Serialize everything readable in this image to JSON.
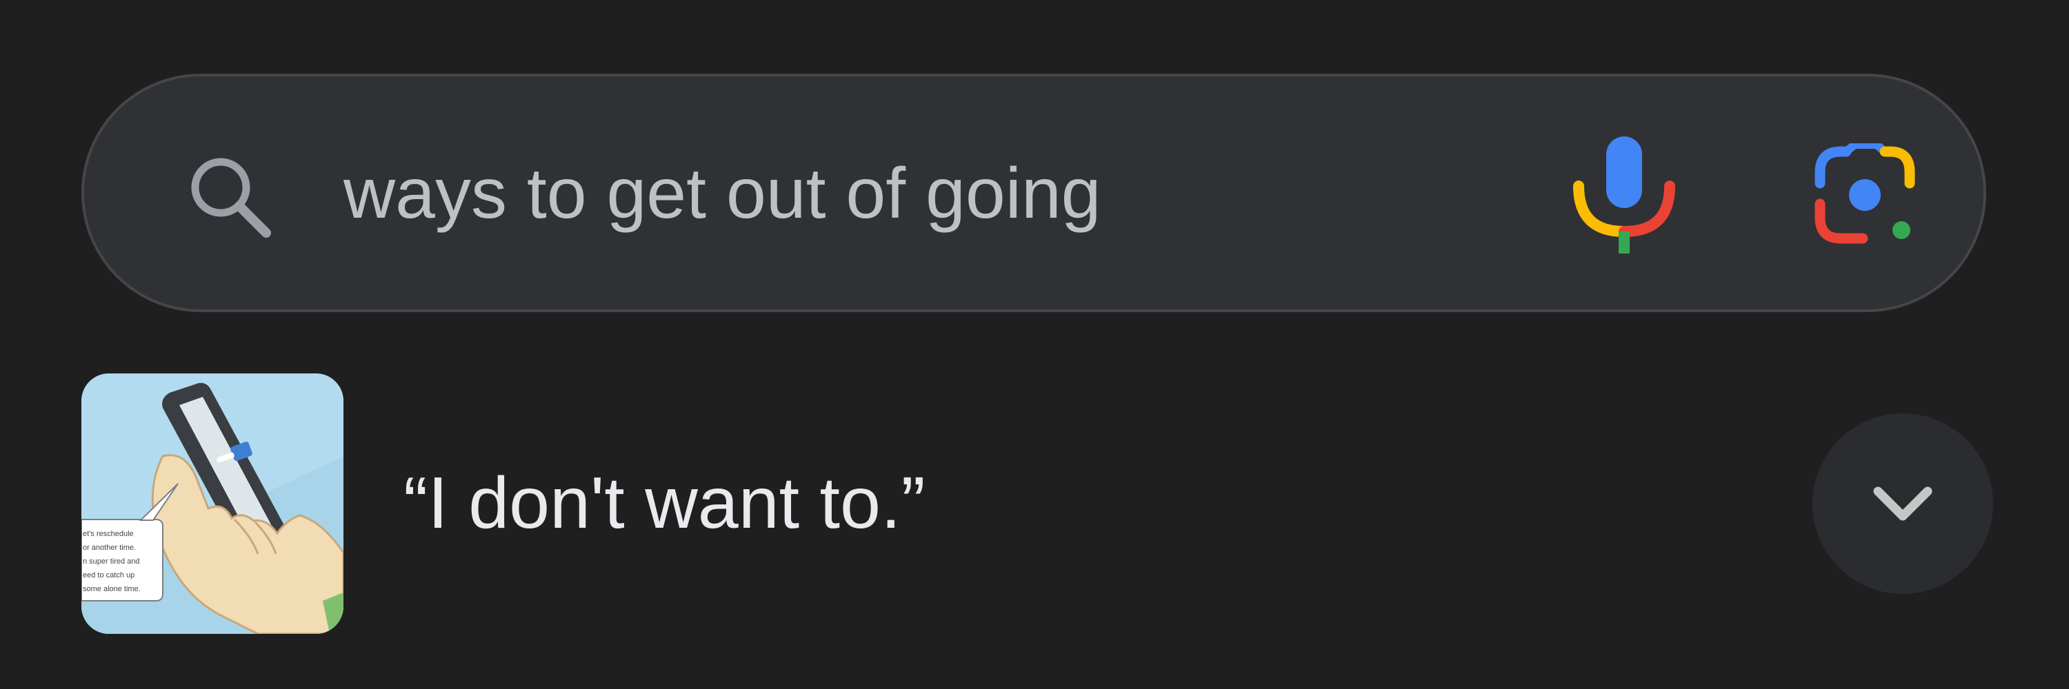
{
  "search": {
    "query": "ways to get out of going",
    "icons": {
      "leading": "search-icon",
      "voice": "microphone-icon",
      "lens": "google-lens-icon"
    }
  },
  "suggestion": {
    "title": "“I don't want to.”",
    "thumbnail": {
      "description_icon": "hand-holding-phone-illustration",
      "speech_lines": [
        "et's reschedule",
        "or another time.",
        "n super tired and",
        "eed to catch up",
        "some alone time."
      ]
    },
    "expand_icon": "chevron-down-icon"
  },
  "colors": {
    "background": "#1f1f1f",
    "search_bar": "#303134",
    "search_border": "#45464a",
    "query_text": "#bdc1c6",
    "title_text": "#e8eaed",
    "google_blue": "#4285f4",
    "google_red": "#ea4335",
    "google_yellow": "#fbbc04",
    "google_green": "#34a853"
  }
}
